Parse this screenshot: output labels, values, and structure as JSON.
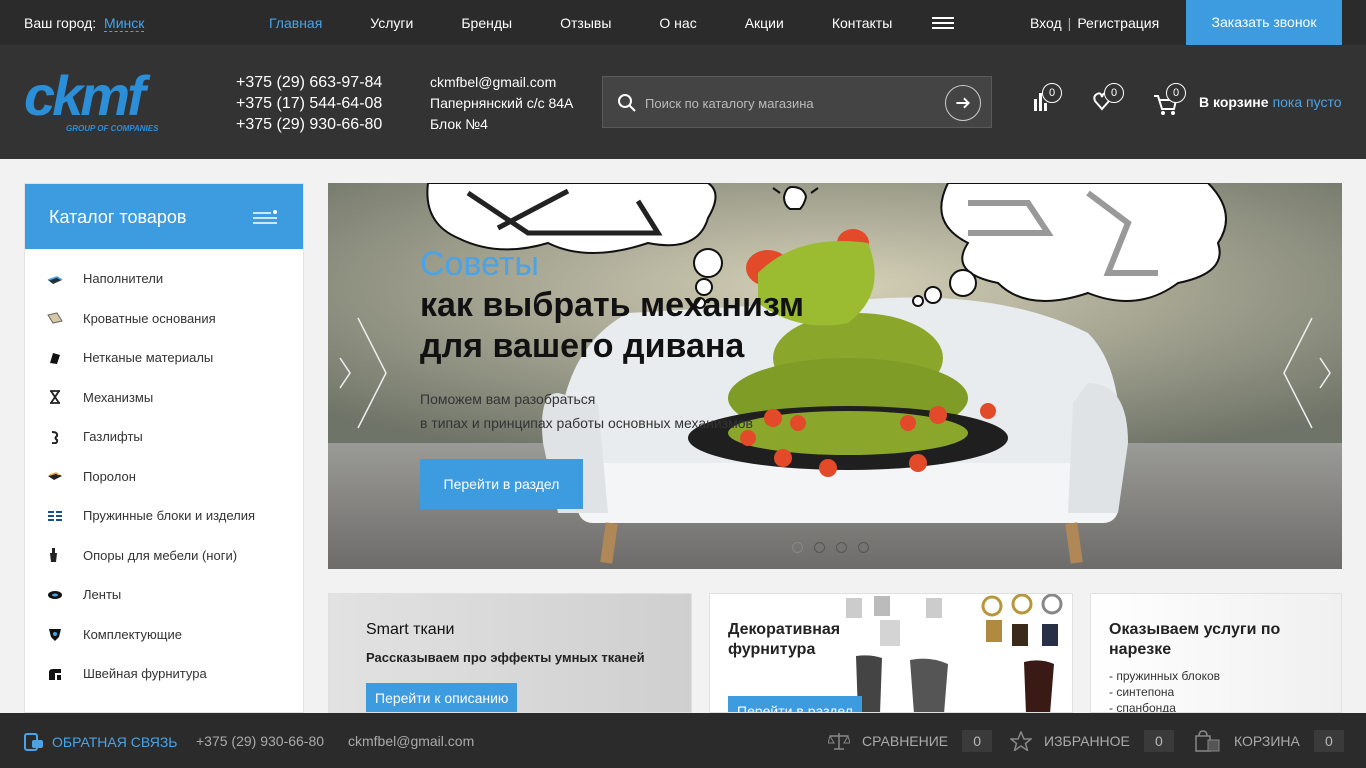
{
  "topbar": {
    "city_label": "Ваш город:",
    "city_value": "Минск",
    "nav": [
      "Главная",
      "Услуги",
      "Бренды",
      "Отзывы",
      "О нас",
      "Акции",
      "Контакты"
    ],
    "login": "Вход",
    "register": "Регистрация",
    "call_button": "Заказать звонок"
  },
  "header": {
    "logo_text": "ckmf",
    "logo_tagline": "GROUP OF COMPANIES",
    "phones": [
      "+375 (29) 663-97-84",
      "+375 (17) 544-64-08",
      "+375 (29) 930-66-80"
    ],
    "email": "ckmfbel@gmail.com",
    "address_line1": "Папернянский с/с 84А",
    "address_line2": "Блок №4",
    "search_placeholder": "Поиск по каталогу магазина",
    "compare_count": "0",
    "favorites_count": "0",
    "cart_count": "0",
    "cart_label": "В корзине",
    "cart_status": "пока пусто"
  },
  "catalog": {
    "title": "Каталог товаров",
    "items": [
      {
        "label": "Наполнители",
        "icon": "filler-icon"
      },
      {
        "label": "Кроватные основания",
        "icon": "bed-base-icon"
      },
      {
        "label": "Нетканые материалы",
        "icon": "nonwoven-icon"
      },
      {
        "label": "Механизмы",
        "icon": "mechanism-icon"
      },
      {
        "label": "Газлифты",
        "icon": "gaslift-icon"
      },
      {
        "label": "Поролон",
        "icon": "foam-icon"
      },
      {
        "label": "Пружинные блоки и изделия",
        "icon": "spring-icon"
      },
      {
        "label": "Опоры для мебели (ноги)",
        "icon": "furniture-leg-icon"
      },
      {
        "label": "Ленты",
        "icon": "tape-icon"
      },
      {
        "label": "Комплектующие",
        "icon": "components-icon"
      },
      {
        "label": "Швейная фурнитура",
        "icon": "sewing-icon"
      }
    ]
  },
  "banner": {
    "title_accent": "Советы",
    "title_main": "как выбрать механизм для вашего дивана",
    "subtitle_line1": "Поможем вам разобраться",
    "subtitle_line2": "в типах и принципах работы основных механизмов",
    "button": "Перейти в раздел"
  },
  "cards": [
    {
      "title": "Smart ткани",
      "desc": "Рассказываем про эффекты умных тканей",
      "button": "Перейти к описанию"
    },
    {
      "title": "Декоративная фурнитура",
      "button": "Перейти в раздел"
    },
    {
      "title": "Оказываем услуги по нарезке",
      "list": [
        "- пружинных блоков",
        "- синтепона",
        "- спанбонда"
      ]
    }
  ],
  "footer": {
    "feedback": "ОБРАТНАЯ СВЯЗЬ",
    "phone": "+375 (29) 930-66-80",
    "email": "ckmfbel@gmail.com",
    "compare": "СРАВНЕНИЕ",
    "compare_count": "0",
    "favorites": "ИЗБРАННОЕ",
    "favorites_count": "0",
    "cart": "КОРЗИНА",
    "cart_count": "0"
  },
  "colors": {
    "accent": "#3d9be0",
    "dark": "#2b2b2b",
    "header": "#333333"
  }
}
